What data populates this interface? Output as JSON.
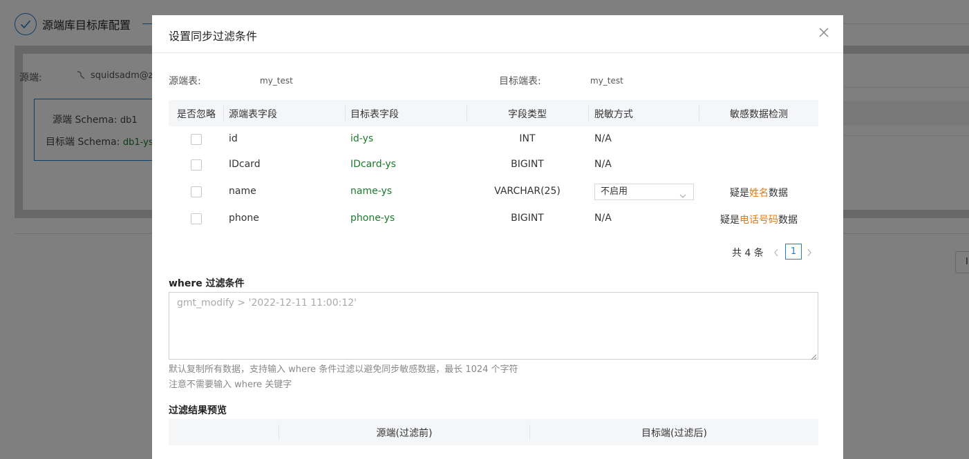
{
  "background": {
    "step1_label": "源端库目标库配置",
    "source_label": "源端:",
    "source_user": "squidsadm@zzi",
    "src_schema_label": "源端 Schema:",
    "src_schema_value": "db1",
    "tgt_schema_label": "目标端 Schema:",
    "tgt_schema_value": "db1-ys",
    "button_partial": "I"
  },
  "modal": {
    "title": "设置同步过滤条件",
    "source_table_label": "源端表:",
    "source_table_value": "my_test",
    "target_table_label": "目标端表:",
    "target_table_value": "my_test",
    "columns": {
      "ignore": "是否忽略",
      "src_field": "源端表字段",
      "tgt_field": "目标表字段",
      "type": "字段类型",
      "mask": "脱敏方式",
      "sensitive": "敏感数据检测"
    },
    "rows": [
      {
        "src": "id",
        "tgt": "id-ys",
        "type": "INT",
        "mask": "N/A"
      },
      {
        "src": "IDcard",
        "tgt": "IDcard-ys",
        "type": "BIGINT",
        "mask": "N/A"
      },
      {
        "src": "name",
        "tgt": "name-ys",
        "type": "VARCHAR(25)",
        "mask_select": "不启用",
        "sens_prefix": "疑是",
        "sens_highlight": "姓名",
        "sens_suffix": "数据"
      },
      {
        "src": "phone",
        "tgt": "phone-ys",
        "type": "BIGINT",
        "mask": "N/A",
        "sens_prefix": "疑是",
        "sens_highlight": "电话号码",
        "sens_suffix": "数据"
      }
    ],
    "pagination": {
      "total_text": "共 4 条",
      "current": "1"
    },
    "where": {
      "title": "where 过滤条件",
      "placeholder": "gmt_modify > '2022-12-11 11:00:12'",
      "hint1": "默认复制所有数据，支持输入 where 条件过滤以避免同步敏感数据，最长 1024 个字符",
      "hint2": "注意不需要输入 where 关键字"
    },
    "preview": {
      "title": "过滤结果预览",
      "col_source": "源端(过滤前)",
      "col_target": "目标端(过滤后)"
    }
  },
  "colors": {
    "accent": "#1f7bd6",
    "target_field": "#1b7a2c",
    "sensitive_highlight": "#e07a16"
  }
}
